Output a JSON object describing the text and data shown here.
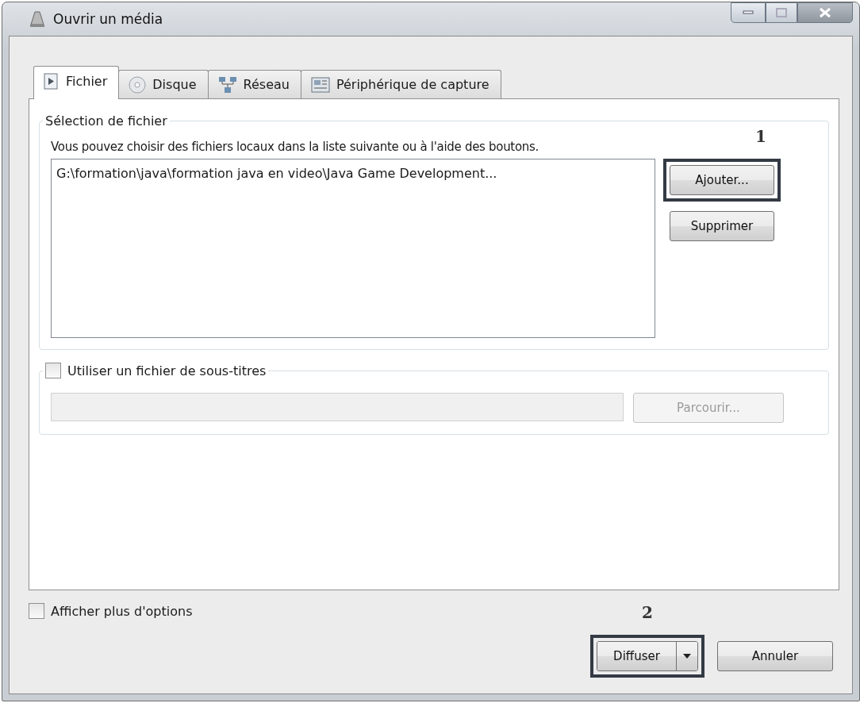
{
  "window": {
    "title": "Ouvrir un média"
  },
  "tabs": [
    {
      "label": "Fichier",
      "kind": "file",
      "selected": true
    },
    {
      "label": "Disque",
      "kind": "disc",
      "selected": false
    },
    {
      "label": "Réseau",
      "kind": "network",
      "selected": false
    },
    {
      "label": "Périphérique de capture",
      "kind": "capture",
      "selected": false
    }
  ],
  "file_selection": {
    "title": "Sélection de fichier",
    "instructions": "Vous pouvez choisir des fichiers locaux dans la liste suivante ou à l'aide des boutons.",
    "files": [
      "G:\\formation\\java\\formation java en video\\Java Game Development..."
    ],
    "buttons": [
      {
        "label": "Ajouter...",
        "highlighted": true,
        "annotation": "1"
      },
      {
        "label": "Supprimer",
        "highlighted": false
      }
    ]
  },
  "subtitles": {
    "label": "Utiliser un fichier de sous-titres",
    "checked": false,
    "browse_button": {
      "label": "Parcourir...",
      "disabled": true
    }
  },
  "more_options": {
    "label": "Afficher plus d'options",
    "checked": false
  },
  "actions": [
    {
      "label": "Diffuser",
      "kind": "split",
      "highlighted": true,
      "annotation": "2"
    },
    {
      "label": "Annuler",
      "kind": "plain",
      "highlighted": false
    }
  ]
}
